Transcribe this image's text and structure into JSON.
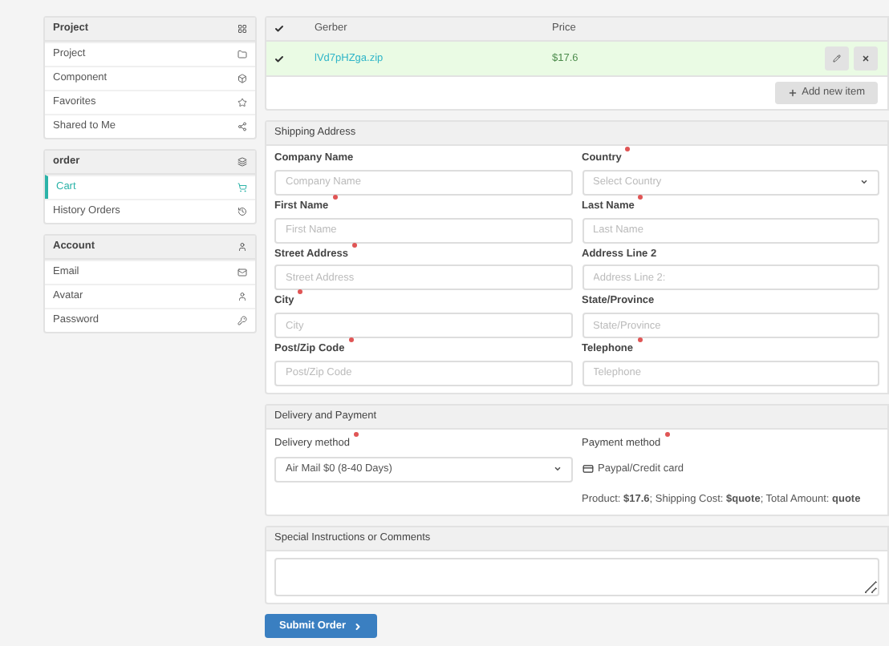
{
  "sidebar": [
    {
      "title": "Project",
      "items": [
        {
          "label": "Project",
          "selected": false
        },
        {
          "label": "Component",
          "selected": false
        },
        {
          "label": "Favorites",
          "selected": false
        },
        {
          "label": "Shared to Me",
          "selected": false
        }
      ]
    },
    {
      "title": "order",
      "items": [
        {
          "label": "Cart",
          "selected": true
        },
        {
          "label": "History Orders",
          "selected": false
        }
      ]
    },
    {
      "title": "Account",
      "items": [
        {
          "label": "Email",
          "selected": false
        },
        {
          "label": "Avatar",
          "selected": false
        },
        {
          "label": "Password",
          "selected": false
        }
      ]
    }
  ],
  "cart": {
    "all_checked": true,
    "columns": [
      "Gerber",
      "Price"
    ],
    "rows": [
      {
        "file": "lVd7pHZga.zip",
        "price": "$17.6",
        "checked": true
      }
    ],
    "add_button": "Add new item"
  },
  "shipping": {
    "title": "Shipping Address",
    "fields": [
      {
        "kind": "input",
        "label": "Company Name",
        "required": false,
        "placeholder": "Company Name"
      },
      {
        "kind": "select",
        "label": "Country",
        "required": true,
        "placeholder": "Select Country"
      },
      {
        "kind": "input",
        "label": "First Name",
        "required": true,
        "placeholder": "First Name"
      },
      {
        "kind": "input",
        "label": "Last Name",
        "required": true,
        "placeholder": "Last Name"
      },
      {
        "kind": "input",
        "label": "Street Address",
        "required": true,
        "placeholder": "Street Address"
      },
      {
        "kind": "input",
        "label": "Address Line 2",
        "required": false,
        "placeholder": "Address Line 2:"
      },
      {
        "kind": "input",
        "label": "City",
        "required": true,
        "placeholder": "City"
      },
      {
        "kind": "input",
        "label": "State/Province",
        "required": false,
        "placeholder": "State/Province"
      },
      {
        "kind": "input",
        "label": "Post/Zip Code",
        "required": true,
        "placeholder": "Post/Zip Code"
      },
      {
        "kind": "input",
        "label": "Telephone",
        "required": true,
        "placeholder": "Telephone"
      }
    ]
  },
  "delivery": {
    "title": "Delivery and Payment",
    "delivery_label": "Delivery method",
    "delivery_required": true,
    "delivery_value": "Air Mail $0 (8-40 Days)",
    "payment_label": "Payment method",
    "payment_required": true,
    "payment_option": "Paypal/Credit card",
    "summary": "Product: **$17.6**; Shipping Cost: **$quote**; Total Amount: **quote**"
  },
  "comments": {
    "title": "Special Instructions or Comments"
  },
  "submit": "Submit Order"
}
